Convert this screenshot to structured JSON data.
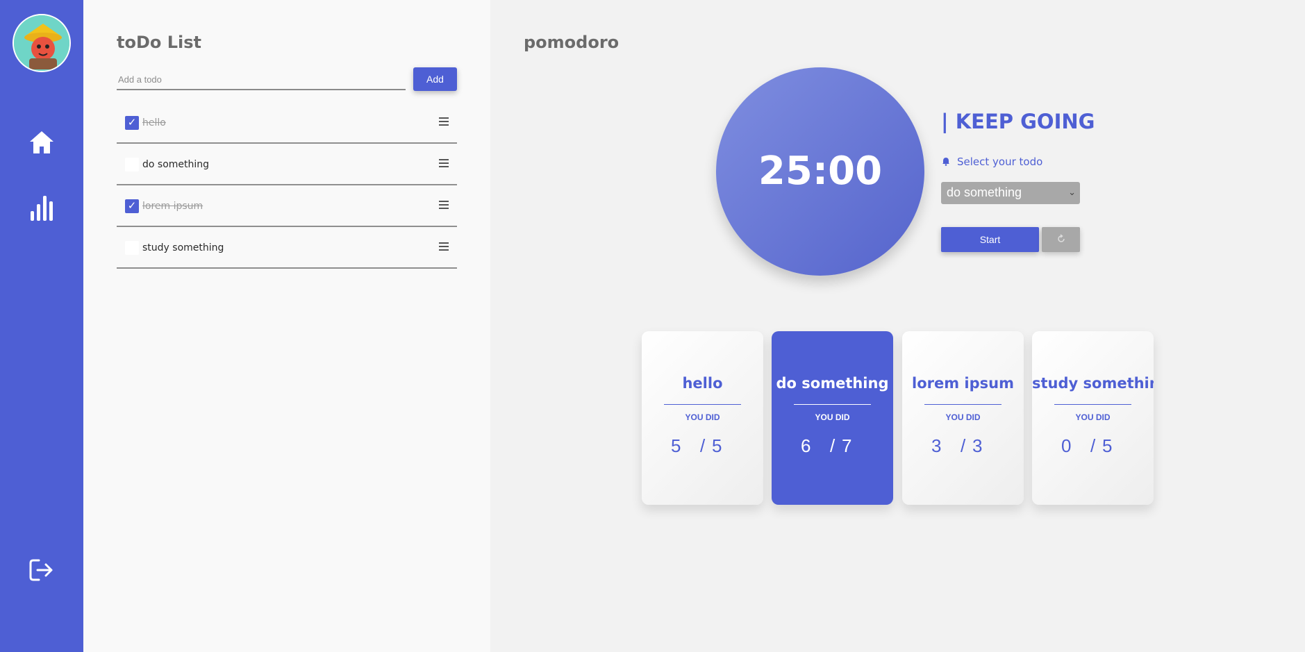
{
  "todo": {
    "title": "toDo List",
    "input_placeholder": "Add a todo",
    "add_label": "Add",
    "items": [
      {
        "label": "hello",
        "done": true
      },
      {
        "label": "do something",
        "done": false
      },
      {
        "label": "lorem ipsum",
        "done": true
      },
      {
        "label": "study something",
        "done": false
      }
    ]
  },
  "pomodoro": {
    "title": "pomodoro",
    "timer": "25:00",
    "heading": "| KEEP GOING",
    "select_label": "Select your todo",
    "selected_todo": "do something",
    "start_label": "Start",
    "cards": [
      {
        "title": "hello",
        "sub": "YOU DID",
        "done": "5",
        "slash": "/",
        "total": "5"
      },
      {
        "title": "do something",
        "sub": "YOU DID",
        "done": "6",
        "slash": "/",
        "total": "7"
      },
      {
        "title": "lorem ipsum",
        "sub": "YOU DID",
        "done": "3",
        "slash": "/",
        "total": "3"
      },
      {
        "title": "study something",
        "sub": "YOU DID",
        "done": "0",
        "slash": "/",
        "total": "5"
      }
    ]
  },
  "colors": {
    "accent": "#4e5fd4",
    "muted": "#a8a8a8"
  },
  "icons": {
    "home": "home-icon",
    "stats": "bar-chart-icon",
    "logout": "logout-icon",
    "bell": "bell-icon",
    "reset": "reset-icon"
  }
}
